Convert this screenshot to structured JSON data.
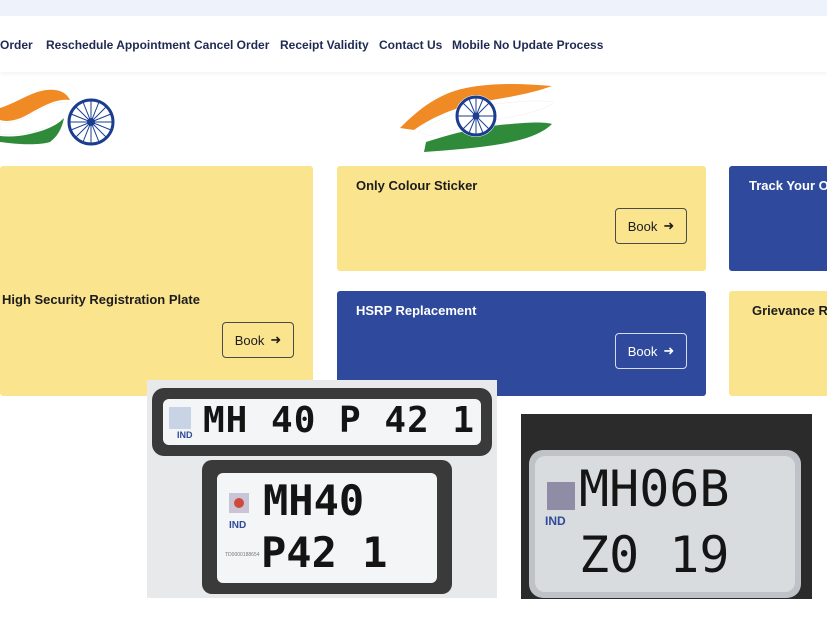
{
  "nav": {
    "items": [
      {
        "label": "Order"
      },
      {
        "label": "Reschedule Appointment"
      },
      {
        "label": "Cancel Order"
      },
      {
        "label": "Receipt Validity"
      },
      {
        "label": "Contact Us"
      },
      {
        "label": "Mobile No Update Process"
      }
    ]
  },
  "cards": {
    "hsrp": {
      "title": "High Security Registration Plate",
      "button": "Book"
    },
    "sticker": {
      "title": "Only Colour Sticker",
      "button": "Book"
    },
    "track": {
      "title": "Track Your O"
    },
    "replacement": {
      "title": "HSRP Replacement",
      "button": "Book"
    },
    "grievance": {
      "title": "Grievance R"
    }
  },
  "plates": {
    "top_plate": {
      "country": "IND",
      "text": "MH 40 P 42 1"
    },
    "square_plate": {
      "country": "IND",
      "line1": "MH40",
      "line2": "P42 1",
      "serial": "TD0000188654"
    },
    "right_plate": {
      "country": "IND",
      "line1": "MH06B",
      "line2": "Z0 19"
    }
  },
  "colors": {
    "yellow_card": "#fbe48e",
    "blue_card": "#2f4a9c",
    "nav_text": "#1f2a52",
    "saffron": "#f08a24",
    "green": "#2f8a3a",
    "chakra": "#1a3d8f"
  }
}
